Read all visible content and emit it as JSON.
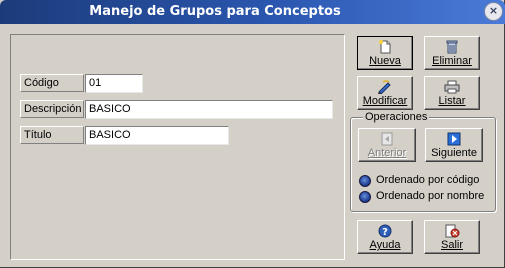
{
  "window": {
    "title": "Manejo de Grupos para Conceptos",
    "close_glyph": "×"
  },
  "form": {
    "codigo": {
      "label": "Código",
      "value": "01"
    },
    "descripcion": {
      "label": "Descripción",
      "value": "BASICO"
    },
    "titulo": {
      "label": "Título",
      "value": "BASICO"
    }
  },
  "buttons": {
    "nueva": {
      "label": "Nueva",
      "icon": "new-document-icon"
    },
    "eliminar": {
      "label": "Eliminar",
      "icon": "trash-icon"
    },
    "modificar": {
      "label": "Modificar",
      "icon": "edit-pencil-icon"
    },
    "listar": {
      "label": "Listar",
      "icon": "printer-icon"
    },
    "anterior": {
      "label": "Anterior",
      "icon": "back-icon",
      "enabled": false
    },
    "siguiente": {
      "label": "Siguiente",
      "icon": "play-next-icon"
    },
    "ayuda": {
      "label": "Ayuda",
      "icon": "help-icon"
    },
    "salir": {
      "label": "Salir",
      "icon": "exit-door-icon"
    }
  },
  "operaciones": {
    "title": "Operaciones",
    "options": [
      {
        "label": "Ordenado por código"
      },
      {
        "label": "Ordenado por nombre"
      }
    ]
  },
  "colors": {
    "title_bar": "#2b57b0",
    "face": "#d4d0c8",
    "radio": "#274aa0"
  }
}
